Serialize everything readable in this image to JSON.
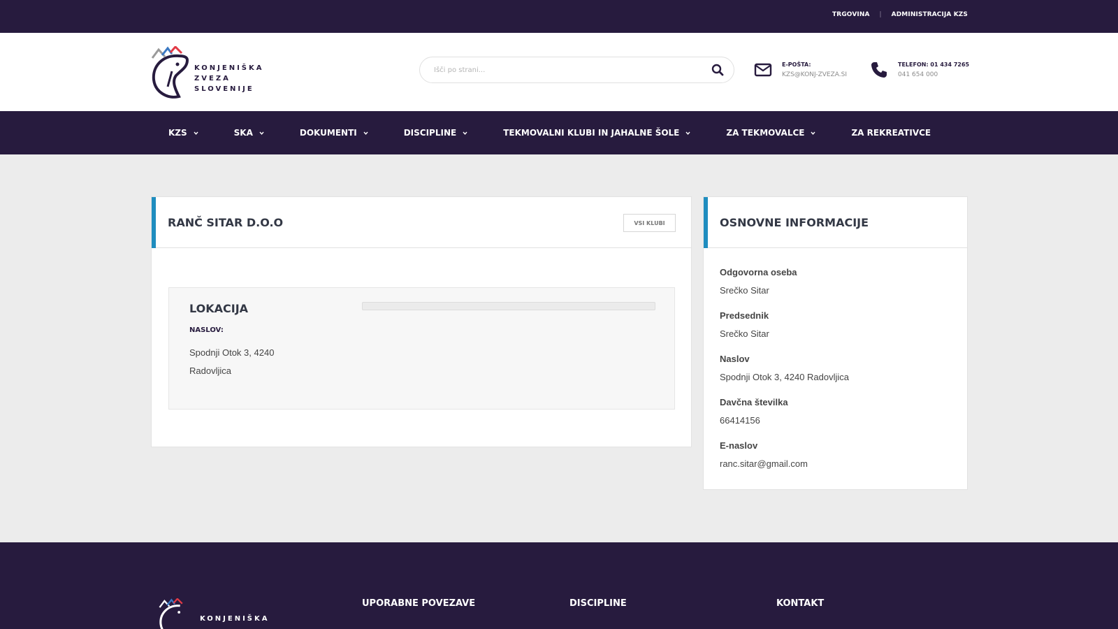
{
  "topbar": {
    "links": [
      "TRGOVINA",
      "ADMINISTRACIJA KZS"
    ],
    "separator": "|"
  },
  "header": {
    "logo_lines": [
      "KONJENIŠKA",
      "ZVEZA",
      "SLOVENIJE"
    ],
    "search": {
      "placeholder": "Išči po strani..."
    },
    "email": {
      "label": "E-POŠTA:",
      "value": "KZS@KONJ-ZVEZA.SI",
      "icon": "envelope-icon"
    },
    "phone": {
      "label": "TELEFON: 01 434 7265",
      "value": "041 654 000",
      "icon": "phone-icon"
    }
  },
  "nav": {
    "items": [
      {
        "label": "KZS",
        "dropdown": true
      },
      {
        "label": "SKA",
        "dropdown": true
      },
      {
        "label": "DOKUMENTI",
        "dropdown": true
      },
      {
        "label": "DISCIPLINE",
        "dropdown": true
      },
      {
        "label": "TEKMOVALNI KLUBI IN JAHALNE ŠOLE",
        "dropdown": true
      },
      {
        "label": "ZA TEKMOVALCE",
        "dropdown": true
      },
      {
        "label": "ZA REKREATIVCE",
        "dropdown": false
      }
    ]
  },
  "main": {
    "title": "RANČ SITAR D.O.O",
    "all_clubs_button": "VSI KLUBI",
    "location": {
      "title": "LOKACIJA",
      "address_label": "NASLOV:",
      "address": "Spodnji Otok 3, 4240 Radovljica"
    }
  },
  "sidebar": {
    "title": "OSNOVNE INFORMACIJE",
    "fields": [
      {
        "label": "Odgovorna oseba",
        "value": "Srečko Sitar"
      },
      {
        "label": "Predsednik",
        "value": "Srečko Sitar"
      },
      {
        "label": "Naslov",
        "value": "Spodnji Otok 3, 4240 Radovljica"
      },
      {
        "label": "Davčna številka",
        "value": "66414156"
      },
      {
        "label": "E-naslov",
        "value": "ranc.sitar@gmail.com"
      }
    ]
  },
  "footer": {
    "logo_text": "KONJENIŠKA",
    "headings": [
      "UPORABNE POVEZAVE",
      "DISCIPLINE",
      "KONTAKT"
    ]
  },
  "colors": {
    "brand_dark": "#271b3e",
    "accent_blue": "#1f8dbf",
    "logo_red": "#e23a46",
    "logo_blue": "#3a78c2",
    "logo_gray": "#9a9a9a"
  }
}
